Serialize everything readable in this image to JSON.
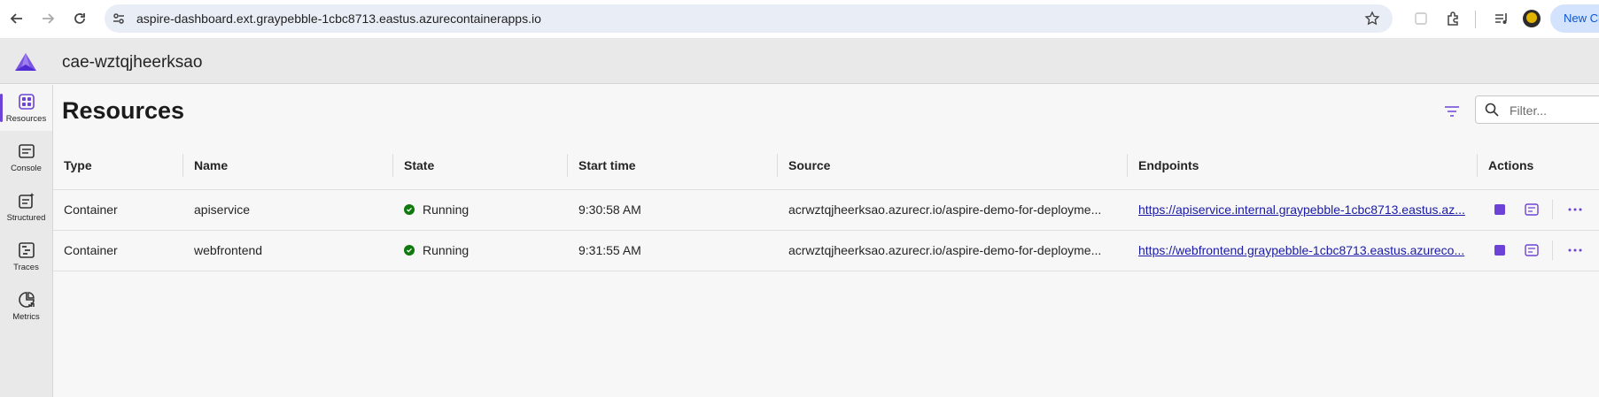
{
  "browser": {
    "url": "aspire-dashboard.ext.graypebble-1cbc8713.eastus.azurecontainerapps.io",
    "new_chat_label": "New Ch"
  },
  "app": {
    "title": "cae-wztqjheerksao",
    "accent_color": "#6c43d6"
  },
  "nav": {
    "items": [
      {
        "label": "Resources",
        "icon": "grid-icon"
      },
      {
        "label": "Console",
        "icon": "console-icon"
      },
      {
        "label": "Structured",
        "icon": "structured-logs-icon"
      },
      {
        "label": "Traces",
        "icon": "traces-icon"
      },
      {
        "label": "Metrics",
        "icon": "metrics-icon"
      }
    ]
  },
  "page": {
    "title": "Resources",
    "filter_placeholder": "Filter..."
  },
  "table": {
    "headers": [
      "Type",
      "Name",
      "State",
      "Start time",
      "Source",
      "Endpoints",
      "Actions"
    ],
    "rows": [
      {
        "type": "Container",
        "name": "apiservice",
        "state": "Running",
        "start_time": "9:30:58 AM",
        "source": "acrwztqjheerksao.azurecr.io/aspire-demo-for-deployme...",
        "endpoint": "https://apiservice.internal.graypebble-1cbc8713.eastus.az..."
      },
      {
        "type": "Container",
        "name": "webfrontend",
        "state": "Running",
        "start_time": "9:31:55 AM",
        "source": "acrwztqjheerksao.azurecr.io/aspire-demo-for-deployme...",
        "endpoint": "https://webfrontend.graypebble-1cbc8713.eastus.azureco..."
      }
    ]
  }
}
